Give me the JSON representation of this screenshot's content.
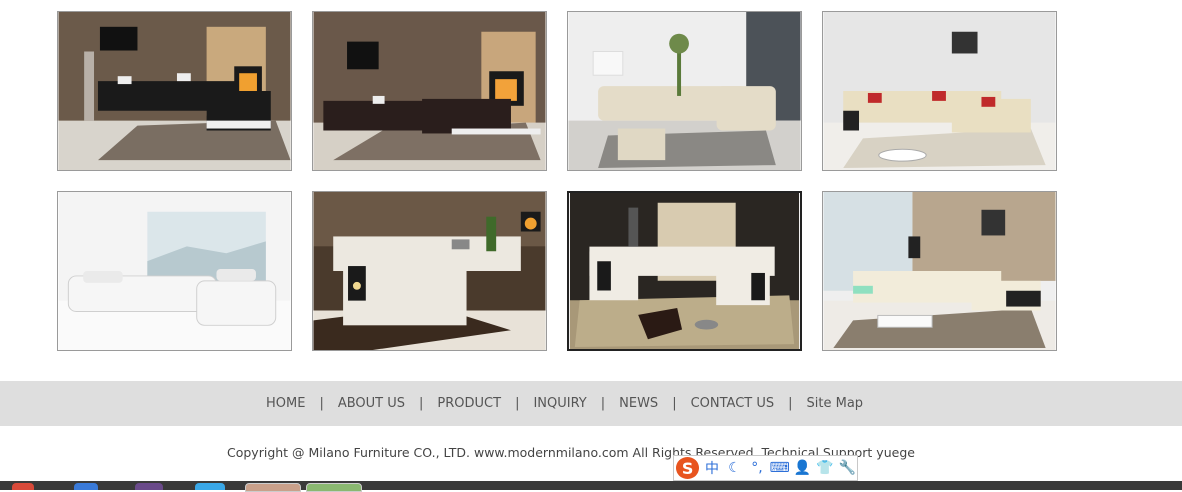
{
  "gallery": {
    "thumbnails": [
      {
        "name": "sofa-black-fireplace-1",
        "scheme": "dark"
      },
      {
        "name": "sofa-black-fireplace-2",
        "scheme": "dark"
      },
      {
        "name": "sofa-cream-curved",
        "scheme": "cream"
      },
      {
        "name": "sofa-cream-red-pillows",
        "scheme": "cream"
      },
      {
        "name": "sofa-white-modular",
        "scheme": "white"
      },
      {
        "name": "sofa-white-chaise",
        "scheme": "white"
      },
      {
        "name": "sofa-white-u-shaped",
        "scheme": "white"
      },
      {
        "name": "sofa-cream-led",
        "scheme": "cream"
      }
    ]
  },
  "footer": {
    "nav": [
      {
        "label": "HOME"
      },
      {
        "label": "ABOUT US"
      },
      {
        "label": "PRODUCT"
      },
      {
        "label": "INQUIRY"
      },
      {
        "label": "NEWS"
      },
      {
        "label": "CONTACT US"
      },
      {
        "label": "Site Map"
      }
    ],
    "separator": "|",
    "copyright": "Copyright @ Milano Furniture CO., LTD. www.modernmilano.com All Rights Reserved. Technical Support yuege"
  },
  "ime": {
    "logo": "S",
    "mode": "中",
    "icons": [
      "moon-icon",
      "punctuation-icon",
      "keyboard-icon",
      "user-icon",
      "shirt-icon",
      "wrench-icon"
    ]
  },
  "colors": {
    "footer_bg": "#dedede",
    "ime_accent": "#2d6fd8",
    "ime_logo": "#e8541f"
  }
}
